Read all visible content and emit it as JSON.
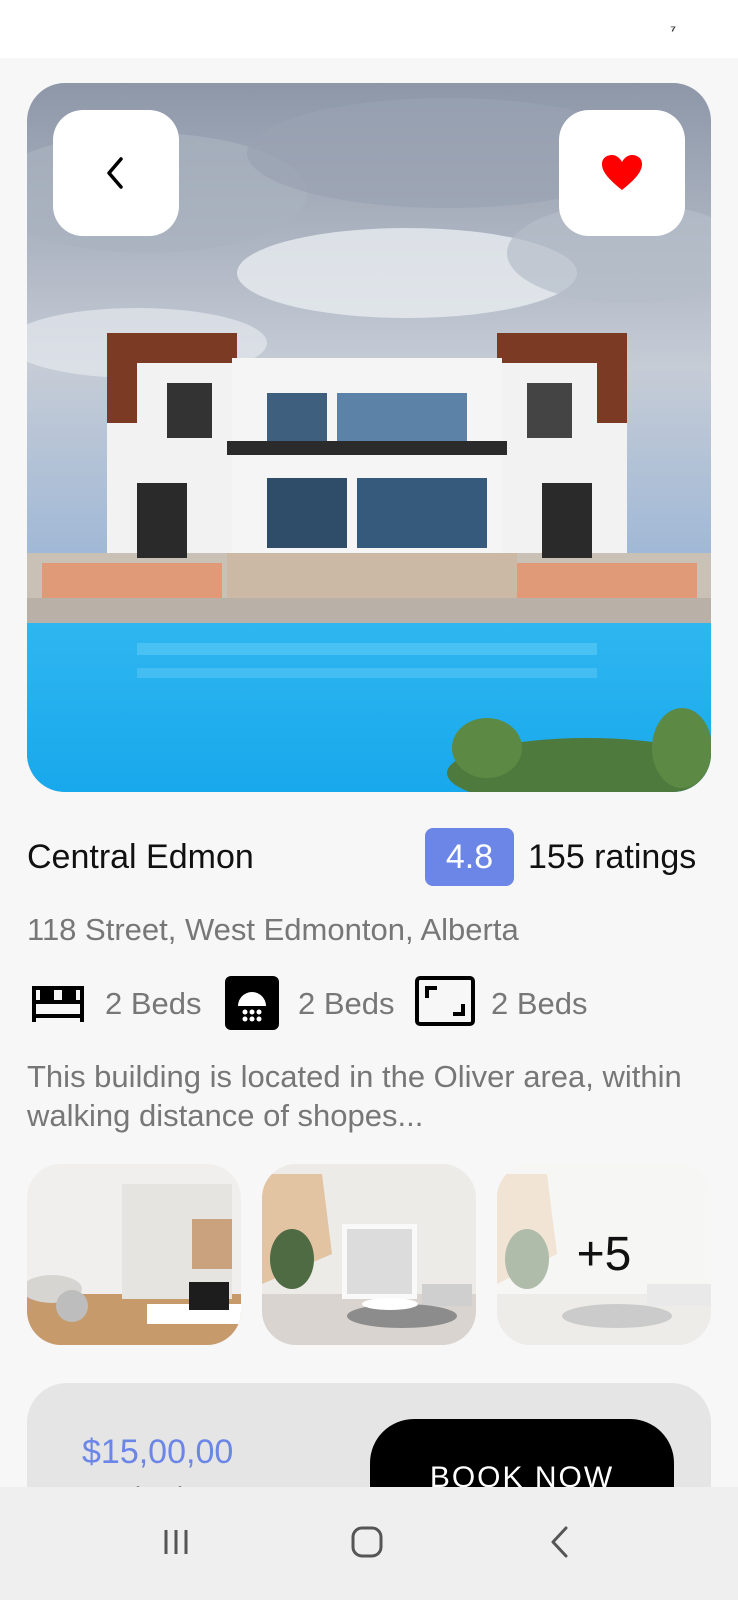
{
  "status_bar": {
    "glyph": "⁷"
  },
  "header": {
    "back_icon": "chevron-left-icon",
    "favorite_icon": "heart-icon",
    "favorite_color": "#ff0000"
  },
  "property": {
    "name": "Central Edmon",
    "rating": "4.8",
    "rating_count": "155 ratings",
    "address": "118 Street, West Edmonton, Alberta",
    "features": [
      {
        "icon": "bed-icon",
        "label": "2 Beds"
      },
      {
        "icon": "shower-icon",
        "label": "2 Beds"
      },
      {
        "icon": "area-icon",
        "label": "2 Beds"
      }
    ],
    "description": "This building is located in the Oliver area, within walking distance of shopes..."
  },
  "gallery": {
    "more_count": "+5"
  },
  "booking": {
    "price": "$15,00,00",
    "price_caption": "Total Price",
    "button_label": "BOOK NOW"
  },
  "colors": {
    "accent": "#6b86e6",
    "background": "#f7f7f7",
    "card": "#e5e5e5"
  }
}
